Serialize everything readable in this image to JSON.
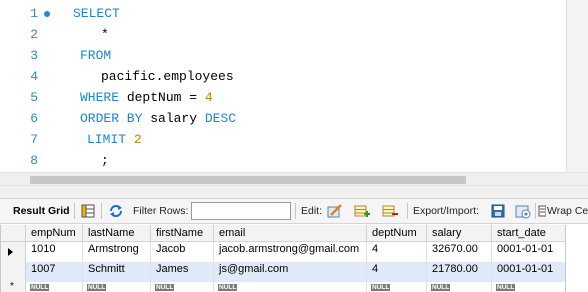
{
  "editor": {
    "lines": [
      {
        "n": "1",
        "tokens": [
          {
            "t": "SELECT",
            "k": "kw"
          }
        ]
      },
      {
        "n": "2",
        "tokens": [
          {
            "t": "*",
            "k": ""
          }
        ]
      },
      {
        "n": "3",
        "tokens": [
          {
            "t": "FROM",
            "k": "kw"
          }
        ]
      },
      {
        "n": "4",
        "tokens": [
          {
            "t": "pacific.employees",
            "k": ""
          }
        ]
      },
      {
        "n": "5",
        "tokens": [
          {
            "t": "WHERE",
            "k": "kw"
          },
          {
            "t": " deptNum = ",
            "k": ""
          },
          {
            "t": "4",
            "k": "num"
          }
        ]
      },
      {
        "n": "6",
        "tokens": [
          {
            "t": "ORDER BY",
            "k": "kw"
          },
          {
            "t": " salary ",
            "k": ""
          },
          {
            "t": "DESC",
            "k": "kw"
          }
        ]
      },
      {
        "n": "7",
        "tokens": [
          {
            "t": "LIMIT",
            "k": "kw"
          },
          {
            "t": " ",
            "k": ""
          },
          {
            "t": "2",
            "k": "num"
          }
        ]
      },
      {
        "n": "8",
        "tokens": [
          {
            "t": ";",
            "k": ""
          }
        ]
      }
    ]
  },
  "toolbar": {
    "result_grid_label": "Result Grid",
    "filter_rows_label": "Filter Rows:",
    "filter_rows_value": "",
    "edit_label": "Edit:",
    "export_import_label": "Export/Import:",
    "wrap_label": "Wrap Ce"
  },
  "grid": {
    "columns": [
      "empNum",
      "lastName",
      "firstName",
      "email",
      "deptNum",
      "salary",
      "start_date"
    ],
    "rows": [
      [
        "1010",
        "Armstrong",
        "Jacob",
        "jacob.armstrong@gmail.com",
        "4",
        "32670.00",
        "0001-01-01"
      ],
      [
        "1007",
        "Schmitt",
        "James",
        "js@gmail.com",
        "4",
        "21780.00",
        "0001-01-01"
      ]
    ],
    "null_label": "NULL",
    "new_row_marker": "*"
  },
  "colors": {
    "keyword": "#1a86d0",
    "number": "#cf7a00",
    "line_number": "#2b91af",
    "selected_row": "#dfe9f7"
  }
}
